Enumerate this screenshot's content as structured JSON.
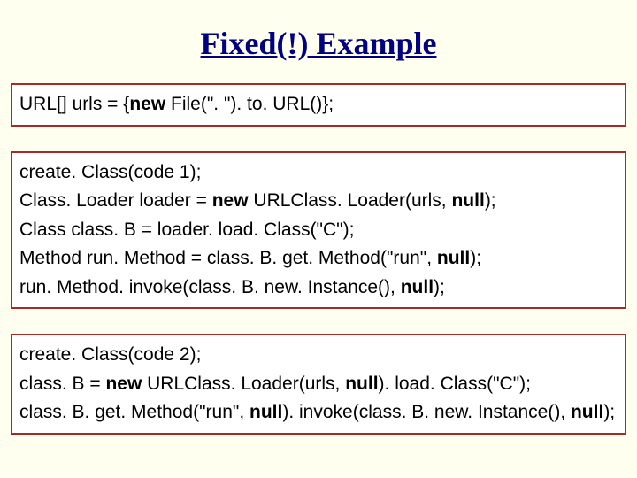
{
  "title": "Fixed(!) Example",
  "blocks": [
    {
      "lines": [
        [
          {
            "t": "URL[] urls = {"
          },
          {
            "t": "new",
            "kw": true
          },
          {
            "t": " File(\". \"). to. URL()}; "
          }
        ]
      ]
    },
    {
      "lines": [
        [
          {
            "t": "create. Class(code 1); "
          }
        ],
        [
          {
            "t": "Class. Loader loader = "
          },
          {
            "t": "new",
            "kw": true
          },
          {
            "t": " URLClass. Loader(urls, "
          },
          {
            "t": "null",
            "kw": true
          },
          {
            "t": "); "
          }
        ],
        [
          {
            "t": "Class class. B = loader. load. Class(\"C\"); "
          }
        ],
        [
          {
            "t": "Method run. Method = class. B. get. Method(\"run\", "
          },
          {
            "t": "null",
            "kw": true
          },
          {
            "t": "); "
          }
        ],
        [
          {
            "t": "run. Method. invoke(class. B. new. Instance(), "
          },
          {
            "t": "null",
            "kw": true
          },
          {
            "t": "); "
          }
        ]
      ]
    },
    {
      "lines": [
        [
          {
            "t": "create. Class(code 2); "
          }
        ],
        [
          {
            "t": "class. B = "
          },
          {
            "t": "new",
            "kw": true
          },
          {
            "t": " URLClass. Loader(urls, "
          },
          {
            "t": "null",
            "kw": true
          },
          {
            "t": "). load. Class(\"C\"); "
          }
        ],
        [
          {
            "t": "class. B. get. Method(\"run\", "
          },
          {
            "t": "null",
            "kw": true
          },
          {
            "t": "). invoke(class. B. new. Instance(), "
          },
          {
            "t": "null",
            "kw": true
          },
          {
            "t": "); "
          }
        ]
      ]
    }
  ]
}
